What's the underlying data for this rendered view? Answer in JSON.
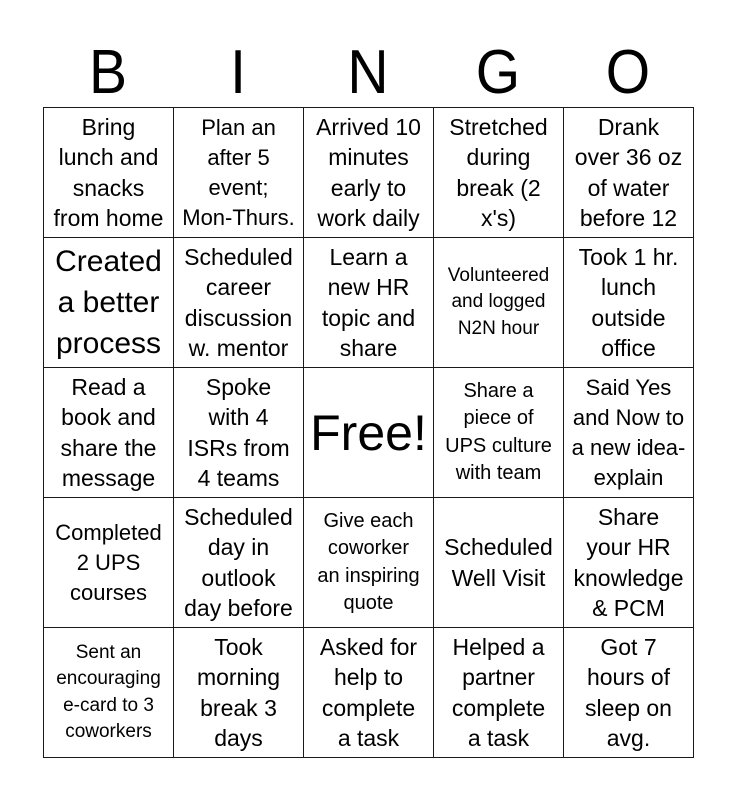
{
  "header": {
    "letters": [
      "B",
      "I",
      "N",
      "G",
      "O"
    ]
  },
  "card": {
    "rows": [
      [
        {
          "text": "Bring\nlunch and\nsnacks\nfrom home"
        },
        {
          "text": "Plan an\nafter 5\nevent;\nMon-Thurs."
        },
        {
          "text": "Arrived 10\nminutes\nearly to\nwork daily"
        },
        {
          "text": "Stretched\nduring\nbreak (2\nx's)"
        },
        {
          "text": "Drank\nover 36 oz\nof water\nbefore 12"
        }
      ],
      [
        {
          "text": "Created\na better\nprocess"
        },
        {
          "text": "Scheduled\ncareer\ndiscussion\nw. mentor"
        },
        {
          "text": "Learn a\nnew HR\ntopic and\nshare"
        },
        {
          "text": "Volunteered\nand logged\nN2N hour"
        },
        {
          "text": "Took 1 hr.\nlunch\noutside\noffice"
        }
      ],
      [
        {
          "text": "Read a\nbook and\nshare the\nmessage"
        },
        {
          "text": "Spoke\nwith 4\nISRs from\n4 teams"
        },
        {
          "text": "Free!"
        },
        {
          "text": "Share a\npiece of\nUPS culture\nwith team"
        },
        {
          "text": "Said Yes\nand Now to\na new idea-\nexplain"
        }
      ],
      [
        {
          "text": "Completed\n2 UPS\ncourses"
        },
        {
          "text": "Scheduled\nday in\noutlook\nday before"
        },
        {
          "text": "Give each\ncoworker\nan inspiring\nquote"
        },
        {
          "text": "Scheduled\nWell Visit"
        },
        {
          "text": "Share\nyour HR\nknowledge\n& PCM"
        }
      ],
      [
        {
          "text": "Sent an\nencouraging\ne-card to 3\ncoworkers"
        },
        {
          "text": "Took\nmorning\nbreak 3\ndays"
        },
        {
          "text": "Asked for\nhelp to\ncomplete\na task"
        },
        {
          "text": "Helped a\npartner\ncomplete\na task"
        },
        {
          "text": "Got 7\nhours of\nsleep on\navg."
        }
      ]
    ]
  }
}
